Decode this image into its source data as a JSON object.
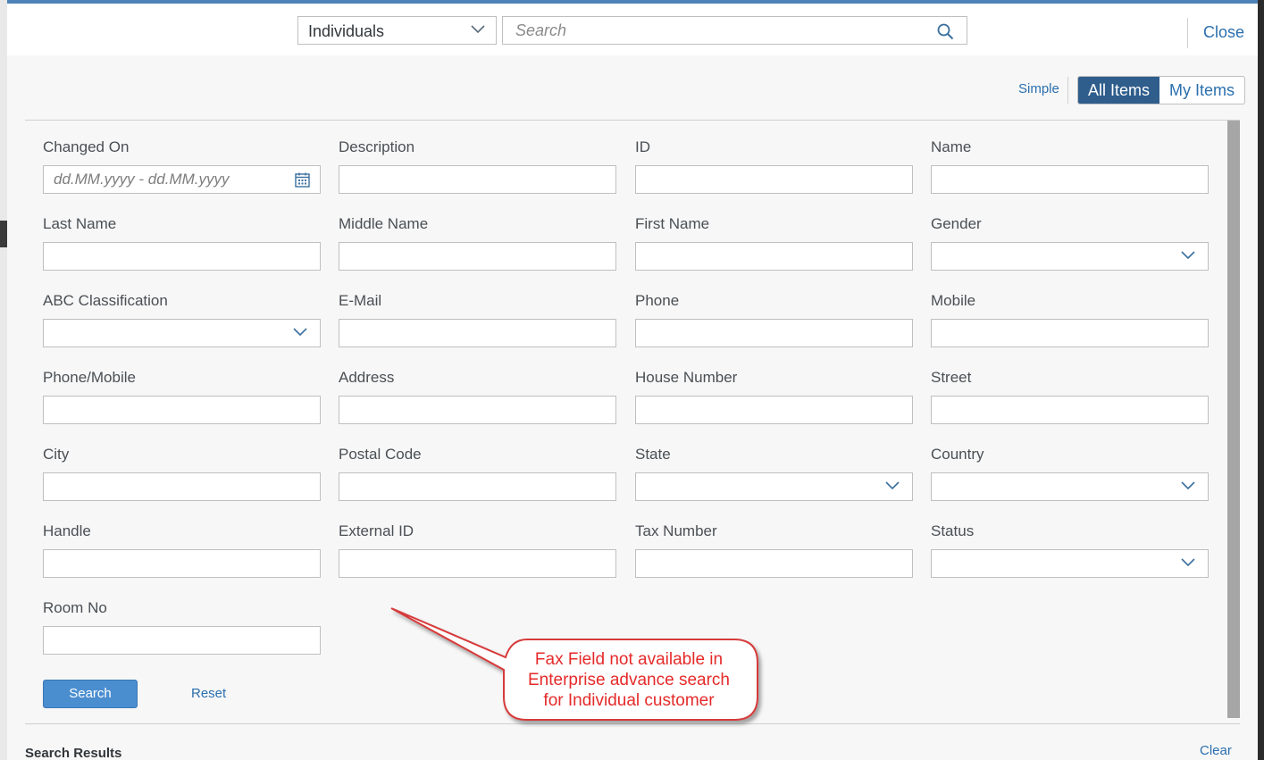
{
  "topbar": {
    "scope_value": "Individuals",
    "search_placeholder": "Search",
    "close_label": "Close"
  },
  "view_toggle": {
    "simple_label": "Simple",
    "all_items_label": "All Items",
    "my_items_label": "My Items",
    "selected": "All Items"
  },
  "form": {
    "fields": [
      {
        "label": "Changed On",
        "type": "date",
        "placeholder": "dd.MM.yyyy - dd.MM.yyyy"
      },
      {
        "label": "Description",
        "type": "text"
      },
      {
        "label": "ID",
        "type": "text"
      },
      {
        "label": "Name",
        "type": "text"
      },
      {
        "label": "Last Name",
        "type": "text"
      },
      {
        "label": "Middle Name",
        "type": "text"
      },
      {
        "label": "First Name",
        "type": "text"
      },
      {
        "label": "Gender",
        "type": "select"
      },
      {
        "label": "ABC Classification",
        "type": "select"
      },
      {
        "label": "E-Mail",
        "type": "text"
      },
      {
        "label": "Phone",
        "type": "text"
      },
      {
        "label": "Mobile",
        "type": "text"
      },
      {
        "label": "Phone/Mobile",
        "type": "text"
      },
      {
        "label": "Address",
        "type": "text"
      },
      {
        "label": "House Number",
        "type": "text"
      },
      {
        "label": "Street",
        "type": "text"
      },
      {
        "label": "City",
        "type": "text"
      },
      {
        "label": "Postal Code",
        "type": "text"
      },
      {
        "label": "State",
        "type": "select"
      },
      {
        "label": "Country",
        "type": "select"
      },
      {
        "label": "Handle",
        "type": "text"
      },
      {
        "label": "External ID",
        "type": "text"
      },
      {
        "label": "Tax Number",
        "type": "text"
      },
      {
        "label": "Status",
        "type": "select"
      },
      {
        "label": "Room No",
        "type": "text"
      }
    ],
    "search_button": "Search",
    "reset_link": "Reset"
  },
  "results": {
    "title": "Search Results",
    "clear_label": "Clear"
  },
  "annotation": {
    "line1": "Fax Field not available in",
    "line2": "Enterprise advance search",
    "line3": "for Individual customer",
    "color": "#e52a2a"
  },
  "colors": {
    "accent": "#2f5d8c",
    "link": "#2b6fae",
    "primary_button": "#4a8ed0"
  }
}
